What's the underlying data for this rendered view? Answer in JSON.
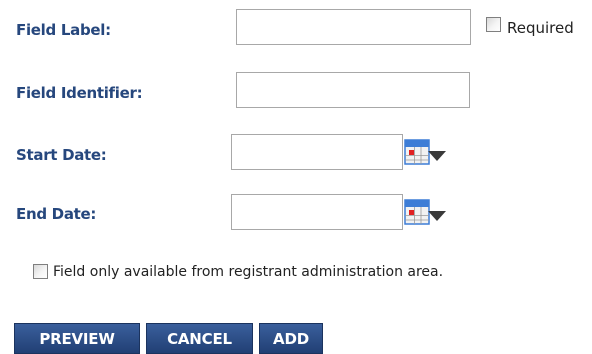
{
  "form": {
    "field_label": {
      "label": "Field Label:",
      "value": ""
    },
    "required": {
      "label": "Required",
      "checked": false
    },
    "field_identifier": {
      "label": "Field Identifier:",
      "value": ""
    },
    "start_date": {
      "label": "Start Date:",
      "value": "",
      "icon": "calendar-dropdown-icon"
    },
    "end_date": {
      "label": "End Date:",
      "value": "",
      "icon": "calendar-dropdown-icon"
    },
    "registrant_only": {
      "label": "Field only available from registrant administration area.",
      "checked": false
    }
  },
  "buttons": {
    "preview": "PREVIEW",
    "cancel": "CANCEL",
    "add": "ADD"
  },
  "colors": {
    "label_text": "#26477d",
    "button_bg": "#2b4a80",
    "calendar_blue": "#3d7dd6",
    "calendar_red": "#e02020"
  }
}
